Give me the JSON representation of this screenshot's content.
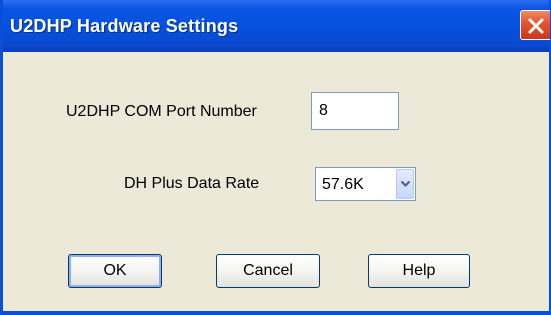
{
  "window": {
    "title": "U2DHP Hardware Settings"
  },
  "icons": {
    "close": "close-icon",
    "dropdown": "chevron-down-icon"
  },
  "form": {
    "com_port": {
      "label": "U2DHP COM Port Number",
      "value": "8"
    },
    "data_rate": {
      "label": "DH Plus Data Rate",
      "selected": "57.6K"
    }
  },
  "buttons": {
    "ok": "OK",
    "cancel": "Cancel",
    "help": "Help"
  },
  "colors": {
    "titlebar": "#0550dc",
    "close_button": "#e2542a",
    "dialog_background": "#ece9d8"
  }
}
